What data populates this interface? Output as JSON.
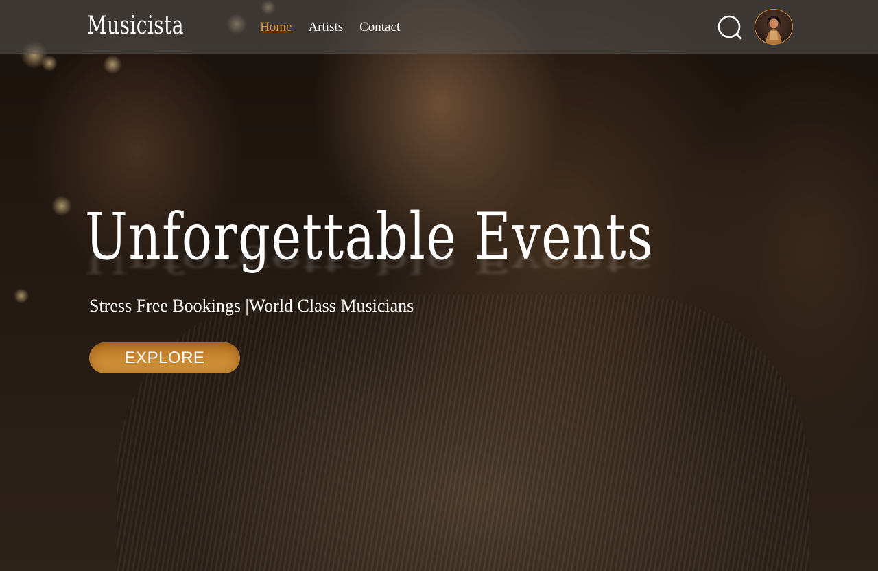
{
  "app": {
    "brand": "Musicista"
  },
  "nav": {
    "items": [
      {
        "label": "Home",
        "active": true
      },
      {
        "label": "Artists",
        "active": false
      },
      {
        "label": "Contact",
        "active": false
      }
    ],
    "search_icon": "search-icon",
    "avatar_icon": "avatar-image"
  },
  "hero": {
    "title": "Unforgettable Events",
    "subtitle": "Stress Free Bookings |World Class Musicians",
    "cta_label": "EXPLORE"
  },
  "colors": {
    "accent": "#d9963f",
    "navbar_bg": "#5a5856",
    "button_gold": "#c8852f",
    "text": "#ffffff"
  }
}
